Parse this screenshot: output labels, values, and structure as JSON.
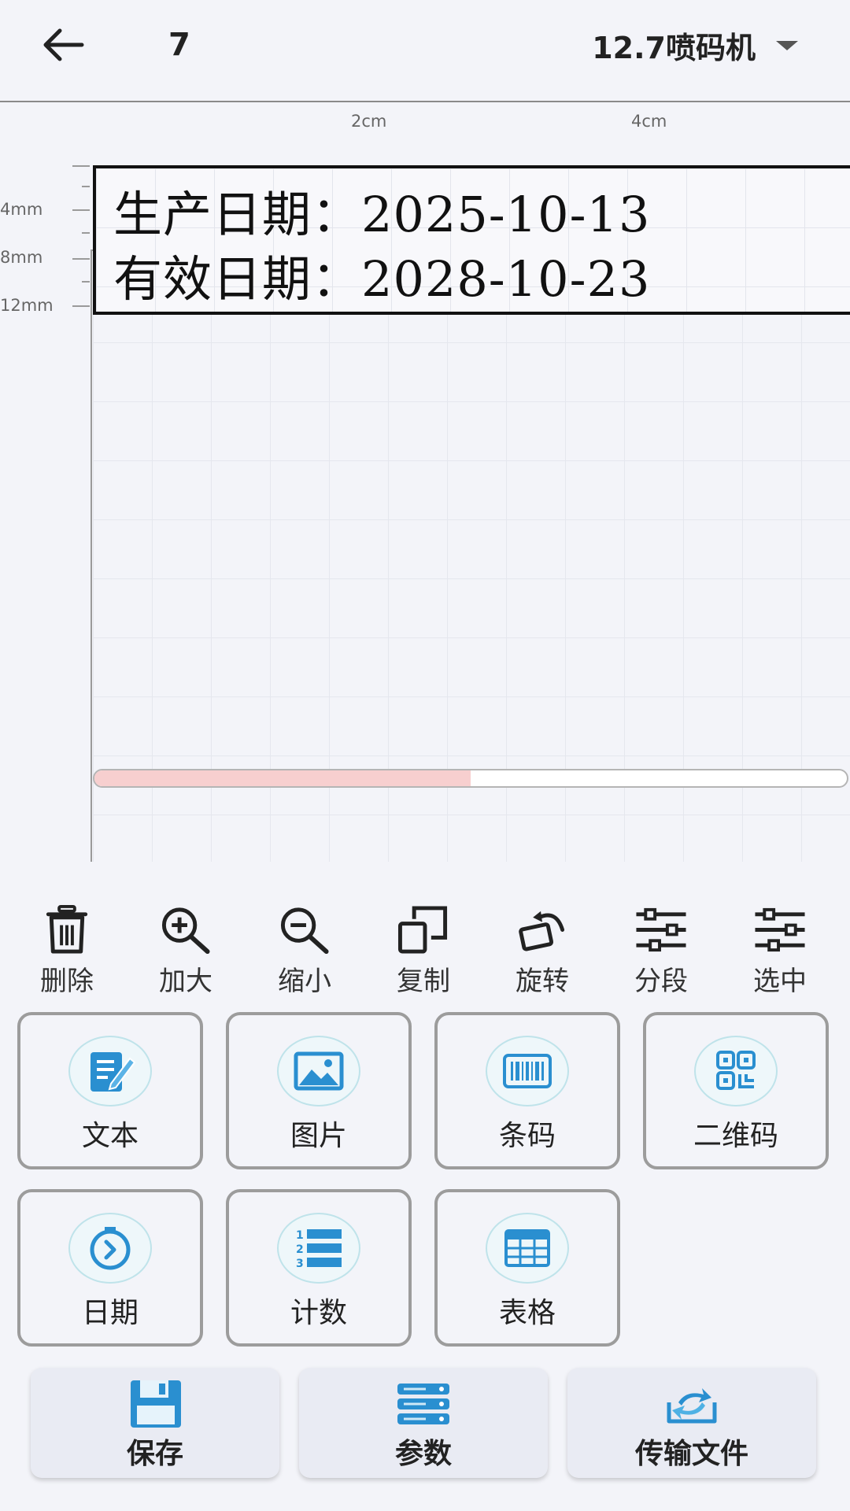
{
  "header": {
    "title": "7",
    "device": "12.7喷码机",
    "icons": {
      "back": "arrow-left-icon",
      "dropdown": "caret-down-icon"
    }
  },
  "ruler": {
    "top_labels": [
      "2cm",
      "4cm"
    ],
    "left_labels": [
      "4mm",
      "8mm",
      "12mm"
    ]
  },
  "label": {
    "lines": [
      "生产日期：2025-10-13",
      "有效日期：2028-10-23"
    ]
  },
  "scroll": {
    "progress": 0.5,
    "fill_color": "#f7cfcf"
  },
  "toolbar": {
    "items": [
      {
        "label": "删除",
        "icon": "trash-icon"
      },
      {
        "label": "加大",
        "icon": "zoom-in-icon"
      },
      {
        "label": "缩小",
        "icon": "zoom-out-icon"
      },
      {
        "label": "复制",
        "icon": "copy-icon"
      },
      {
        "label": "旋转",
        "icon": "rotate-icon"
      },
      {
        "label": "分段",
        "icon": "sliders-icon"
      },
      {
        "label": "选中",
        "icon": "sliders-icon"
      }
    ]
  },
  "insert": {
    "items": [
      {
        "label": "文本",
        "icon": "text-edit-icon"
      },
      {
        "label": "图片",
        "icon": "image-icon"
      },
      {
        "label": "条码",
        "icon": "barcode-icon"
      },
      {
        "label": "二维码",
        "icon": "qrcode-icon"
      },
      {
        "label": "日期",
        "icon": "clock-icon"
      },
      {
        "label": "计数",
        "icon": "numbered-list-icon"
      },
      {
        "label": "表格",
        "icon": "table-icon"
      }
    ]
  },
  "bottom": {
    "items": [
      {
        "label": "保存",
        "icon": "save-icon"
      },
      {
        "label": "参数",
        "icon": "parameters-icon"
      },
      {
        "label": "传输文件",
        "icon": "transfer-icon"
      }
    ]
  },
  "colors": {
    "accent": "#2a8fd0",
    "background": "#f3f4f9",
    "card_border": "#9c9c9c"
  }
}
